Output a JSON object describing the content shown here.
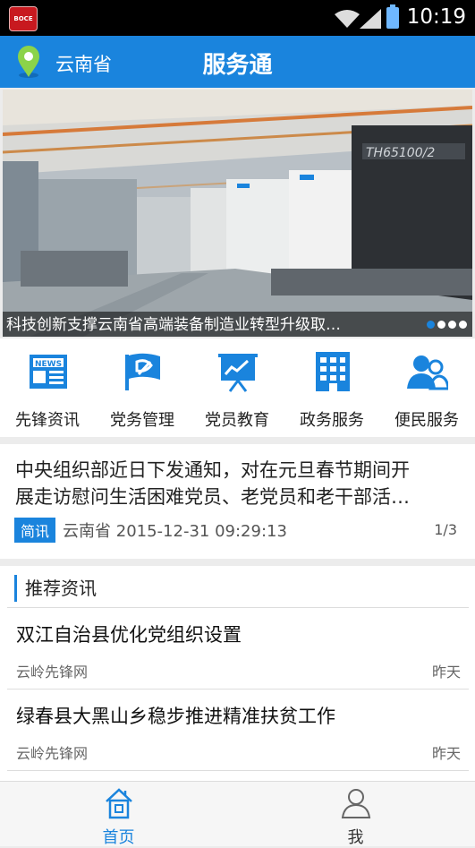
{
  "status": {
    "app_badge": "BOCE",
    "time": "10:19"
  },
  "appbar": {
    "region": "云南省",
    "title": "服务通"
  },
  "banner": {
    "caption": "科技创新支撑云南省高端装备制造业转型升级取…",
    "sign_text": "TH65100/2",
    "slides": 4,
    "active_slide": 1
  },
  "nav": [
    {
      "label": "先锋资讯",
      "icon": "news-icon"
    },
    {
      "label": "党务管理",
      "icon": "party-flag-icon"
    },
    {
      "label": "党员教育",
      "icon": "presentation-board-icon"
    },
    {
      "label": "政务服务",
      "icon": "building-icon"
    },
    {
      "label": "便民服务",
      "icon": "users-icon"
    }
  ],
  "notice": {
    "line1": "中央组织部近日下发通知，对在元旦春节期间开",
    "line2": "展走访慰问生活困难党员、老党员和老干部活…",
    "tag": "简讯",
    "source": "云南省 2015-12-31 09:29:13",
    "page": "1/3"
  },
  "recommend": {
    "heading": "推荐资讯",
    "articles": [
      {
        "title": "双江自治县优化党组织设置",
        "source": "云岭先锋网",
        "date": "昨天"
      },
      {
        "title": "绿春县大黑山乡稳步推进精准扶贫工作",
        "source": "云岭先锋网",
        "date": "昨天"
      }
    ]
  },
  "tabs": [
    {
      "label": "首页",
      "icon": "home-icon",
      "active": true
    },
    {
      "label": "我",
      "icon": "person-icon",
      "active": false
    }
  ],
  "colors": {
    "primary": "#1a84dd",
    "text": "#222222",
    "muted": "#666666"
  }
}
